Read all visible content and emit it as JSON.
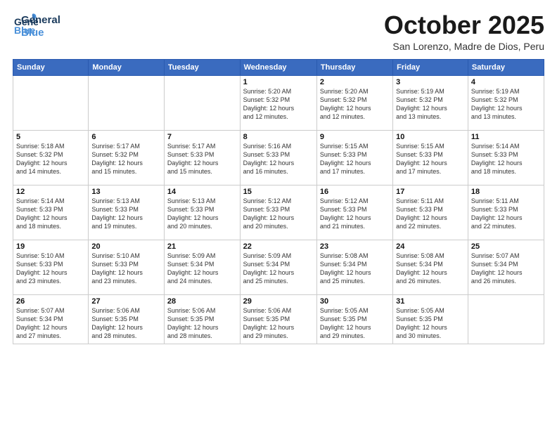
{
  "logo": {
    "line1": "General",
    "line2": "Blue"
  },
  "title": "October 2025",
  "subtitle": "San Lorenzo, Madre de Dios, Peru",
  "weekdays": [
    "Sunday",
    "Monday",
    "Tuesday",
    "Wednesday",
    "Thursday",
    "Friday",
    "Saturday"
  ],
  "weeks": [
    [
      {
        "day": "",
        "detail": ""
      },
      {
        "day": "",
        "detail": ""
      },
      {
        "day": "",
        "detail": ""
      },
      {
        "day": "1",
        "detail": "Sunrise: 5:20 AM\nSunset: 5:32 PM\nDaylight: 12 hours\nand 12 minutes."
      },
      {
        "day": "2",
        "detail": "Sunrise: 5:20 AM\nSunset: 5:32 PM\nDaylight: 12 hours\nand 12 minutes."
      },
      {
        "day": "3",
        "detail": "Sunrise: 5:19 AM\nSunset: 5:32 PM\nDaylight: 12 hours\nand 13 minutes."
      },
      {
        "day": "4",
        "detail": "Sunrise: 5:19 AM\nSunset: 5:32 PM\nDaylight: 12 hours\nand 13 minutes."
      }
    ],
    [
      {
        "day": "5",
        "detail": "Sunrise: 5:18 AM\nSunset: 5:32 PM\nDaylight: 12 hours\nand 14 minutes."
      },
      {
        "day": "6",
        "detail": "Sunrise: 5:17 AM\nSunset: 5:32 PM\nDaylight: 12 hours\nand 15 minutes."
      },
      {
        "day": "7",
        "detail": "Sunrise: 5:17 AM\nSunset: 5:33 PM\nDaylight: 12 hours\nand 15 minutes."
      },
      {
        "day": "8",
        "detail": "Sunrise: 5:16 AM\nSunset: 5:33 PM\nDaylight: 12 hours\nand 16 minutes."
      },
      {
        "day": "9",
        "detail": "Sunrise: 5:15 AM\nSunset: 5:33 PM\nDaylight: 12 hours\nand 17 minutes."
      },
      {
        "day": "10",
        "detail": "Sunrise: 5:15 AM\nSunset: 5:33 PM\nDaylight: 12 hours\nand 17 minutes."
      },
      {
        "day": "11",
        "detail": "Sunrise: 5:14 AM\nSunset: 5:33 PM\nDaylight: 12 hours\nand 18 minutes."
      }
    ],
    [
      {
        "day": "12",
        "detail": "Sunrise: 5:14 AM\nSunset: 5:33 PM\nDaylight: 12 hours\nand 18 minutes."
      },
      {
        "day": "13",
        "detail": "Sunrise: 5:13 AM\nSunset: 5:33 PM\nDaylight: 12 hours\nand 19 minutes."
      },
      {
        "day": "14",
        "detail": "Sunrise: 5:13 AM\nSunset: 5:33 PM\nDaylight: 12 hours\nand 20 minutes."
      },
      {
        "day": "15",
        "detail": "Sunrise: 5:12 AM\nSunset: 5:33 PM\nDaylight: 12 hours\nand 20 minutes."
      },
      {
        "day": "16",
        "detail": "Sunrise: 5:12 AM\nSunset: 5:33 PM\nDaylight: 12 hours\nand 21 minutes."
      },
      {
        "day": "17",
        "detail": "Sunrise: 5:11 AM\nSunset: 5:33 PM\nDaylight: 12 hours\nand 22 minutes."
      },
      {
        "day": "18",
        "detail": "Sunrise: 5:11 AM\nSunset: 5:33 PM\nDaylight: 12 hours\nand 22 minutes."
      }
    ],
    [
      {
        "day": "19",
        "detail": "Sunrise: 5:10 AM\nSunset: 5:33 PM\nDaylight: 12 hours\nand 23 minutes."
      },
      {
        "day": "20",
        "detail": "Sunrise: 5:10 AM\nSunset: 5:33 PM\nDaylight: 12 hours\nand 23 minutes."
      },
      {
        "day": "21",
        "detail": "Sunrise: 5:09 AM\nSunset: 5:34 PM\nDaylight: 12 hours\nand 24 minutes."
      },
      {
        "day": "22",
        "detail": "Sunrise: 5:09 AM\nSunset: 5:34 PM\nDaylight: 12 hours\nand 25 minutes."
      },
      {
        "day": "23",
        "detail": "Sunrise: 5:08 AM\nSunset: 5:34 PM\nDaylight: 12 hours\nand 25 minutes."
      },
      {
        "day": "24",
        "detail": "Sunrise: 5:08 AM\nSunset: 5:34 PM\nDaylight: 12 hours\nand 26 minutes."
      },
      {
        "day": "25",
        "detail": "Sunrise: 5:07 AM\nSunset: 5:34 PM\nDaylight: 12 hours\nand 26 minutes."
      }
    ],
    [
      {
        "day": "26",
        "detail": "Sunrise: 5:07 AM\nSunset: 5:34 PM\nDaylight: 12 hours\nand 27 minutes."
      },
      {
        "day": "27",
        "detail": "Sunrise: 5:06 AM\nSunset: 5:35 PM\nDaylight: 12 hours\nand 28 minutes."
      },
      {
        "day": "28",
        "detail": "Sunrise: 5:06 AM\nSunset: 5:35 PM\nDaylight: 12 hours\nand 28 minutes."
      },
      {
        "day": "29",
        "detail": "Sunrise: 5:06 AM\nSunset: 5:35 PM\nDaylight: 12 hours\nand 29 minutes."
      },
      {
        "day": "30",
        "detail": "Sunrise: 5:05 AM\nSunset: 5:35 PM\nDaylight: 12 hours\nand 29 minutes."
      },
      {
        "day": "31",
        "detail": "Sunrise: 5:05 AM\nSunset: 5:35 PM\nDaylight: 12 hours\nand 30 minutes."
      },
      {
        "day": "",
        "detail": ""
      }
    ]
  ]
}
